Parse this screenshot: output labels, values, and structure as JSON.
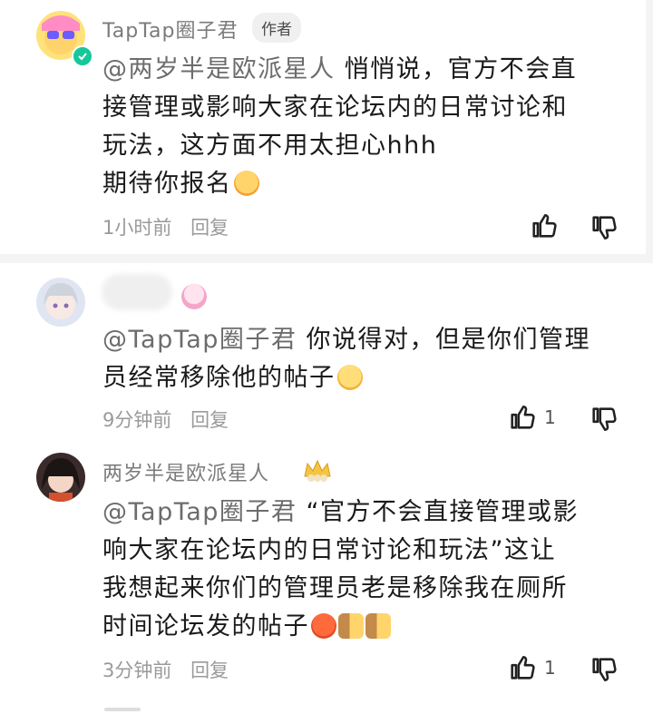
{
  "comments": [
    {
      "author": "TapTap圈子君",
      "author_badge": "作者",
      "mention": "@两岁半是欧派星人",
      "text_lines": [
        "悄悄说，官方不会直",
        "接管理或影响大家在论坛内的日常讨论和",
        "玩法，这方面不用太担心hhh",
        "期待你报名"
      ],
      "time": "1小时前",
      "reply_label": "回复",
      "like_count": ""
    },
    {
      "author": "",
      "mention": "@TapTap圈子君",
      "text_lines": [
        "你说得对，但是你们管理",
        "员经常移除他的帖子"
      ],
      "time": "9分钟前",
      "reply_label": "回复",
      "like_count": "1"
    },
    {
      "author": "两岁半是欧派星人",
      "mention": "@TapTap圈子君",
      "text_lines": [
        "“官方不会直接管理或影",
        "响大家在论坛内的日常讨论和玩法”这让",
        "我想起来你们的管理员老是移除我在厕所",
        "时间论坛发的帖子"
      ],
      "time": "3分钟前",
      "reply_label": "回复",
      "like_count": "1"
    }
  ],
  "colors": {
    "verified": "#16c79a",
    "text": "#1a1a1a",
    "muted": "#9a9a9a"
  },
  "icons": [
    "verified-icon",
    "like-icon",
    "dislike-icon",
    "crown-icon",
    "emoji-shock",
    "emoji-smile",
    "emoji-angry",
    "emoji-door"
  ]
}
